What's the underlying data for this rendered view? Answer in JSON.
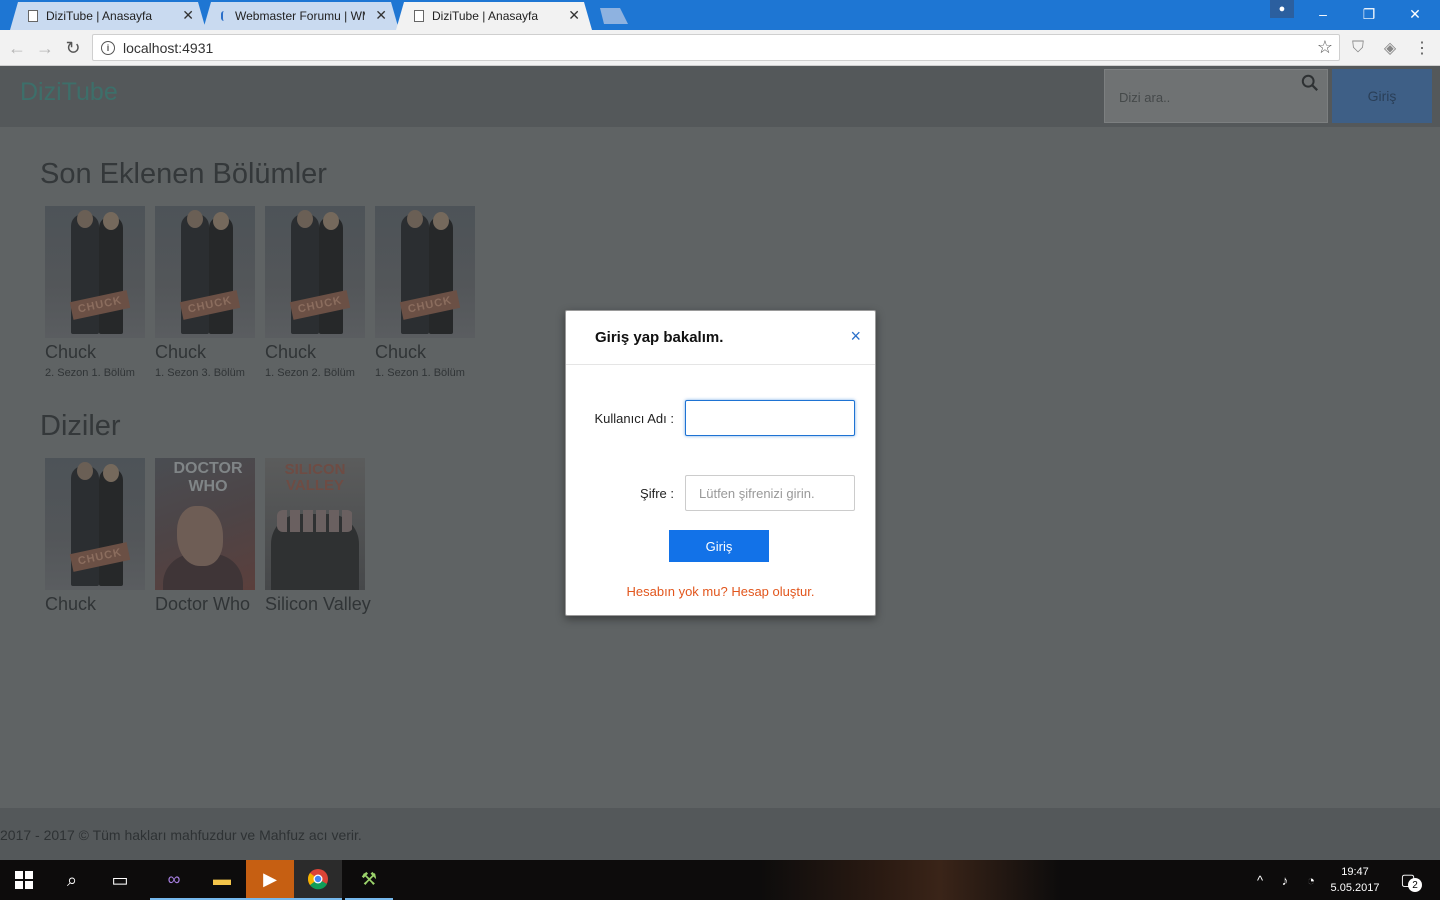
{
  "browser": {
    "tabs": [
      {
        "title": "DiziTube | Anasayfa",
        "active": false,
        "icon": "page-icon"
      },
      {
        "title": "Webmaster Forumu | WM",
        "active": false,
        "icon": "forum-icon"
      },
      {
        "title": "DiziTube | Anasayfa",
        "active": true,
        "icon": "page-icon"
      }
    ],
    "url": "localhost:4931",
    "window_controls": {
      "minimize": "–",
      "restore": "❐",
      "close": "✕"
    }
  },
  "site": {
    "logo": "DiziTube",
    "search_placeholder": "Dizi ara..",
    "login_button": "Giriş",
    "sections": {
      "latest_title": "Son Eklenen Bölümler",
      "series_title": "Diziler"
    },
    "latest_episodes": [
      {
        "title": "Chuck",
        "subtitle": "2. Sezon 1. Bölüm"
      },
      {
        "title": "Chuck",
        "subtitle": "1. Sezon 3. Bölüm"
      },
      {
        "title": "Chuck",
        "subtitle": "1. Sezon 2. Bölüm"
      },
      {
        "title": "Chuck",
        "subtitle": "1. Sezon 1. Bölüm"
      }
    ],
    "series": [
      {
        "title": "Chuck"
      },
      {
        "title": "Doctor Who",
        "poster_text": "DOCTOR WHO"
      },
      {
        "title": "Silicon Valley",
        "poster_text": "SILICON VALLEY"
      }
    ],
    "footer": "2017 - 2017 © Tüm hakları mahfuzdur ve Mahfuz acı verir."
  },
  "modal": {
    "title": "Giriş yap bakalım.",
    "close_icon": "×",
    "username_label": "Kullanıcı Adı :",
    "username_value": "",
    "password_label": "Şifre :",
    "password_placeholder": "Lütfen şifrenizi girin.",
    "submit_label": "Giriş",
    "register_link": "Hesabın yok mu? Hesap oluştur."
  },
  "taskbar": {
    "time": "19:47",
    "date": "5.05.2017",
    "notification_count": "2"
  },
  "colors": {
    "accent": "#1272e8",
    "link": "#e2561d",
    "chrome_titlebar": "#1e76d3"
  }
}
